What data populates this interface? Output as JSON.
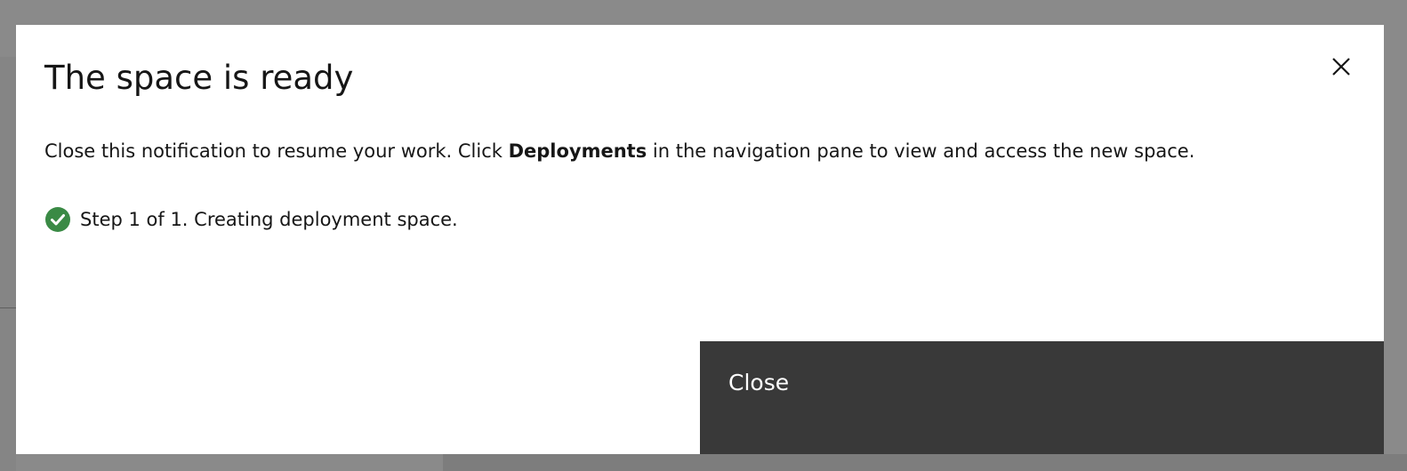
{
  "modal": {
    "title": "The space is ready",
    "body_prefix": "Close this notification to resume your work. Click ",
    "body_bold": "Deployments",
    "body_suffix": " in the navigation pane to view and access the new space.",
    "step_text": "Step 1 of 1. Creating deployment space.",
    "close_button_label": "Close",
    "close_icon": "close-icon",
    "step_icon": "checkmark-filled-icon"
  },
  "colors": {
    "overlay": "#8a8a8a",
    "modal_background": "#ffffff",
    "text": "#161616",
    "success": "#3a8a45",
    "button_background": "#393939",
    "button_text": "#ffffff"
  }
}
